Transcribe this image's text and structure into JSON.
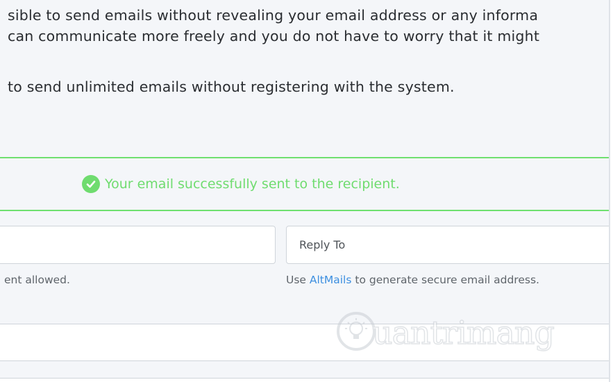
{
  "intro": {
    "line1": "sible to send emails without revealing your email address or any informa",
    "line2": "can communicate more freely and you do not have to worry that it might",
    "line3": "to send unlimited emails without registering with the system."
  },
  "alert": {
    "message": "Your email successfully sent to the recipient.",
    "icon": "check-circle-icon",
    "color": "#6fdc6f"
  },
  "form": {
    "left_help": "ent allowed.",
    "reply_to_placeholder": "Reply To",
    "reply_help_prefix": "Use ",
    "reply_help_link": "AltMails",
    "reply_help_suffix": " to generate secure email address."
  },
  "watermark": {
    "text": "uantrimang",
    "icon": "lightbulb-icon"
  },
  "colors": {
    "success": "#6fdc6f",
    "link": "#3d8fe0",
    "panel_bg": "#f4f6f9"
  }
}
